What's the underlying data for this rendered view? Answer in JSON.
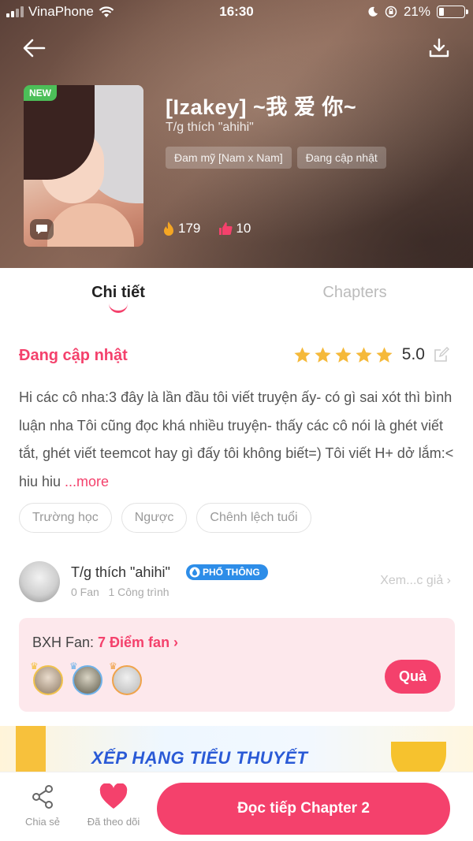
{
  "status_bar": {
    "carrier": "VinaPhone",
    "time": "16:30",
    "battery": "21%",
    "battery_level": 0.21
  },
  "header": {
    "back_icon": "arrow-left-icon",
    "download_icon": "download-icon",
    "new_badge": "NEW",
    "title": "[Izakey] ~我 爱 你~",
    "author_line": "T/g thích \"ahihi\"",
    "tags": [
      "Đam mỹ [Nam x Nam]",
      "Đang cập nhật"
    ],
    "stats": {
      "fire": "179",
      "likes": "10"
    }
  },
  "tabs": {
    "detail": "Chi tiết",
    "chapters": "Chapters",
    "active": "detail"
  },
  "info": {
    "status": "Đang cập nhật",
    "rating_value": "5.0",
    "rating_stars": 5,
    "description": "Hi các cô nha:3 đây là lần đầu tôi viết truyện ấy- có gì sai xót thì bình luận nha Tôi cũng đọc khá nhiều truyện- thấy các cô nói là ghét viết tắt, ghét viết teemcot hay gì đấy tôi không biết=)  Tôi viết H+ dở lắm:< hiu hiu ",
    "more": "...more",
    "tags": [
      "Trường học",
      "Ngược",
      "Chênh lệch tuổi"
    ]
  },
  "author": {
    "name": "T/g thích \"ahihi\"",
    "badge": "PHỔ THÔNG",
    "fans": "0 Fan",
    "works": "1 Công trình",
    "more": "Xem...c giả ›"
  },
  "fan_card": {
    "label": "BXH Fan: ",
    "points": "7 Điểm fan ›",
    "gift_button": "Quà"
  },
  "banner": {
    "text": "XẾP HẠNG TIỂU THUYẾT"
  },
  "bottom_bar": {
    "share": "Chia sẻ",
    "follow": "Đã theo dõi",
    "read": "Đọc tiếp Chapter 2"
  },
  "colors": {
    "accent": "#f4416c",
    "new_badge": "#4cbf58",
    "author_badge": "#2d8de8",
    "star": "#f5b93a"
  }
}
